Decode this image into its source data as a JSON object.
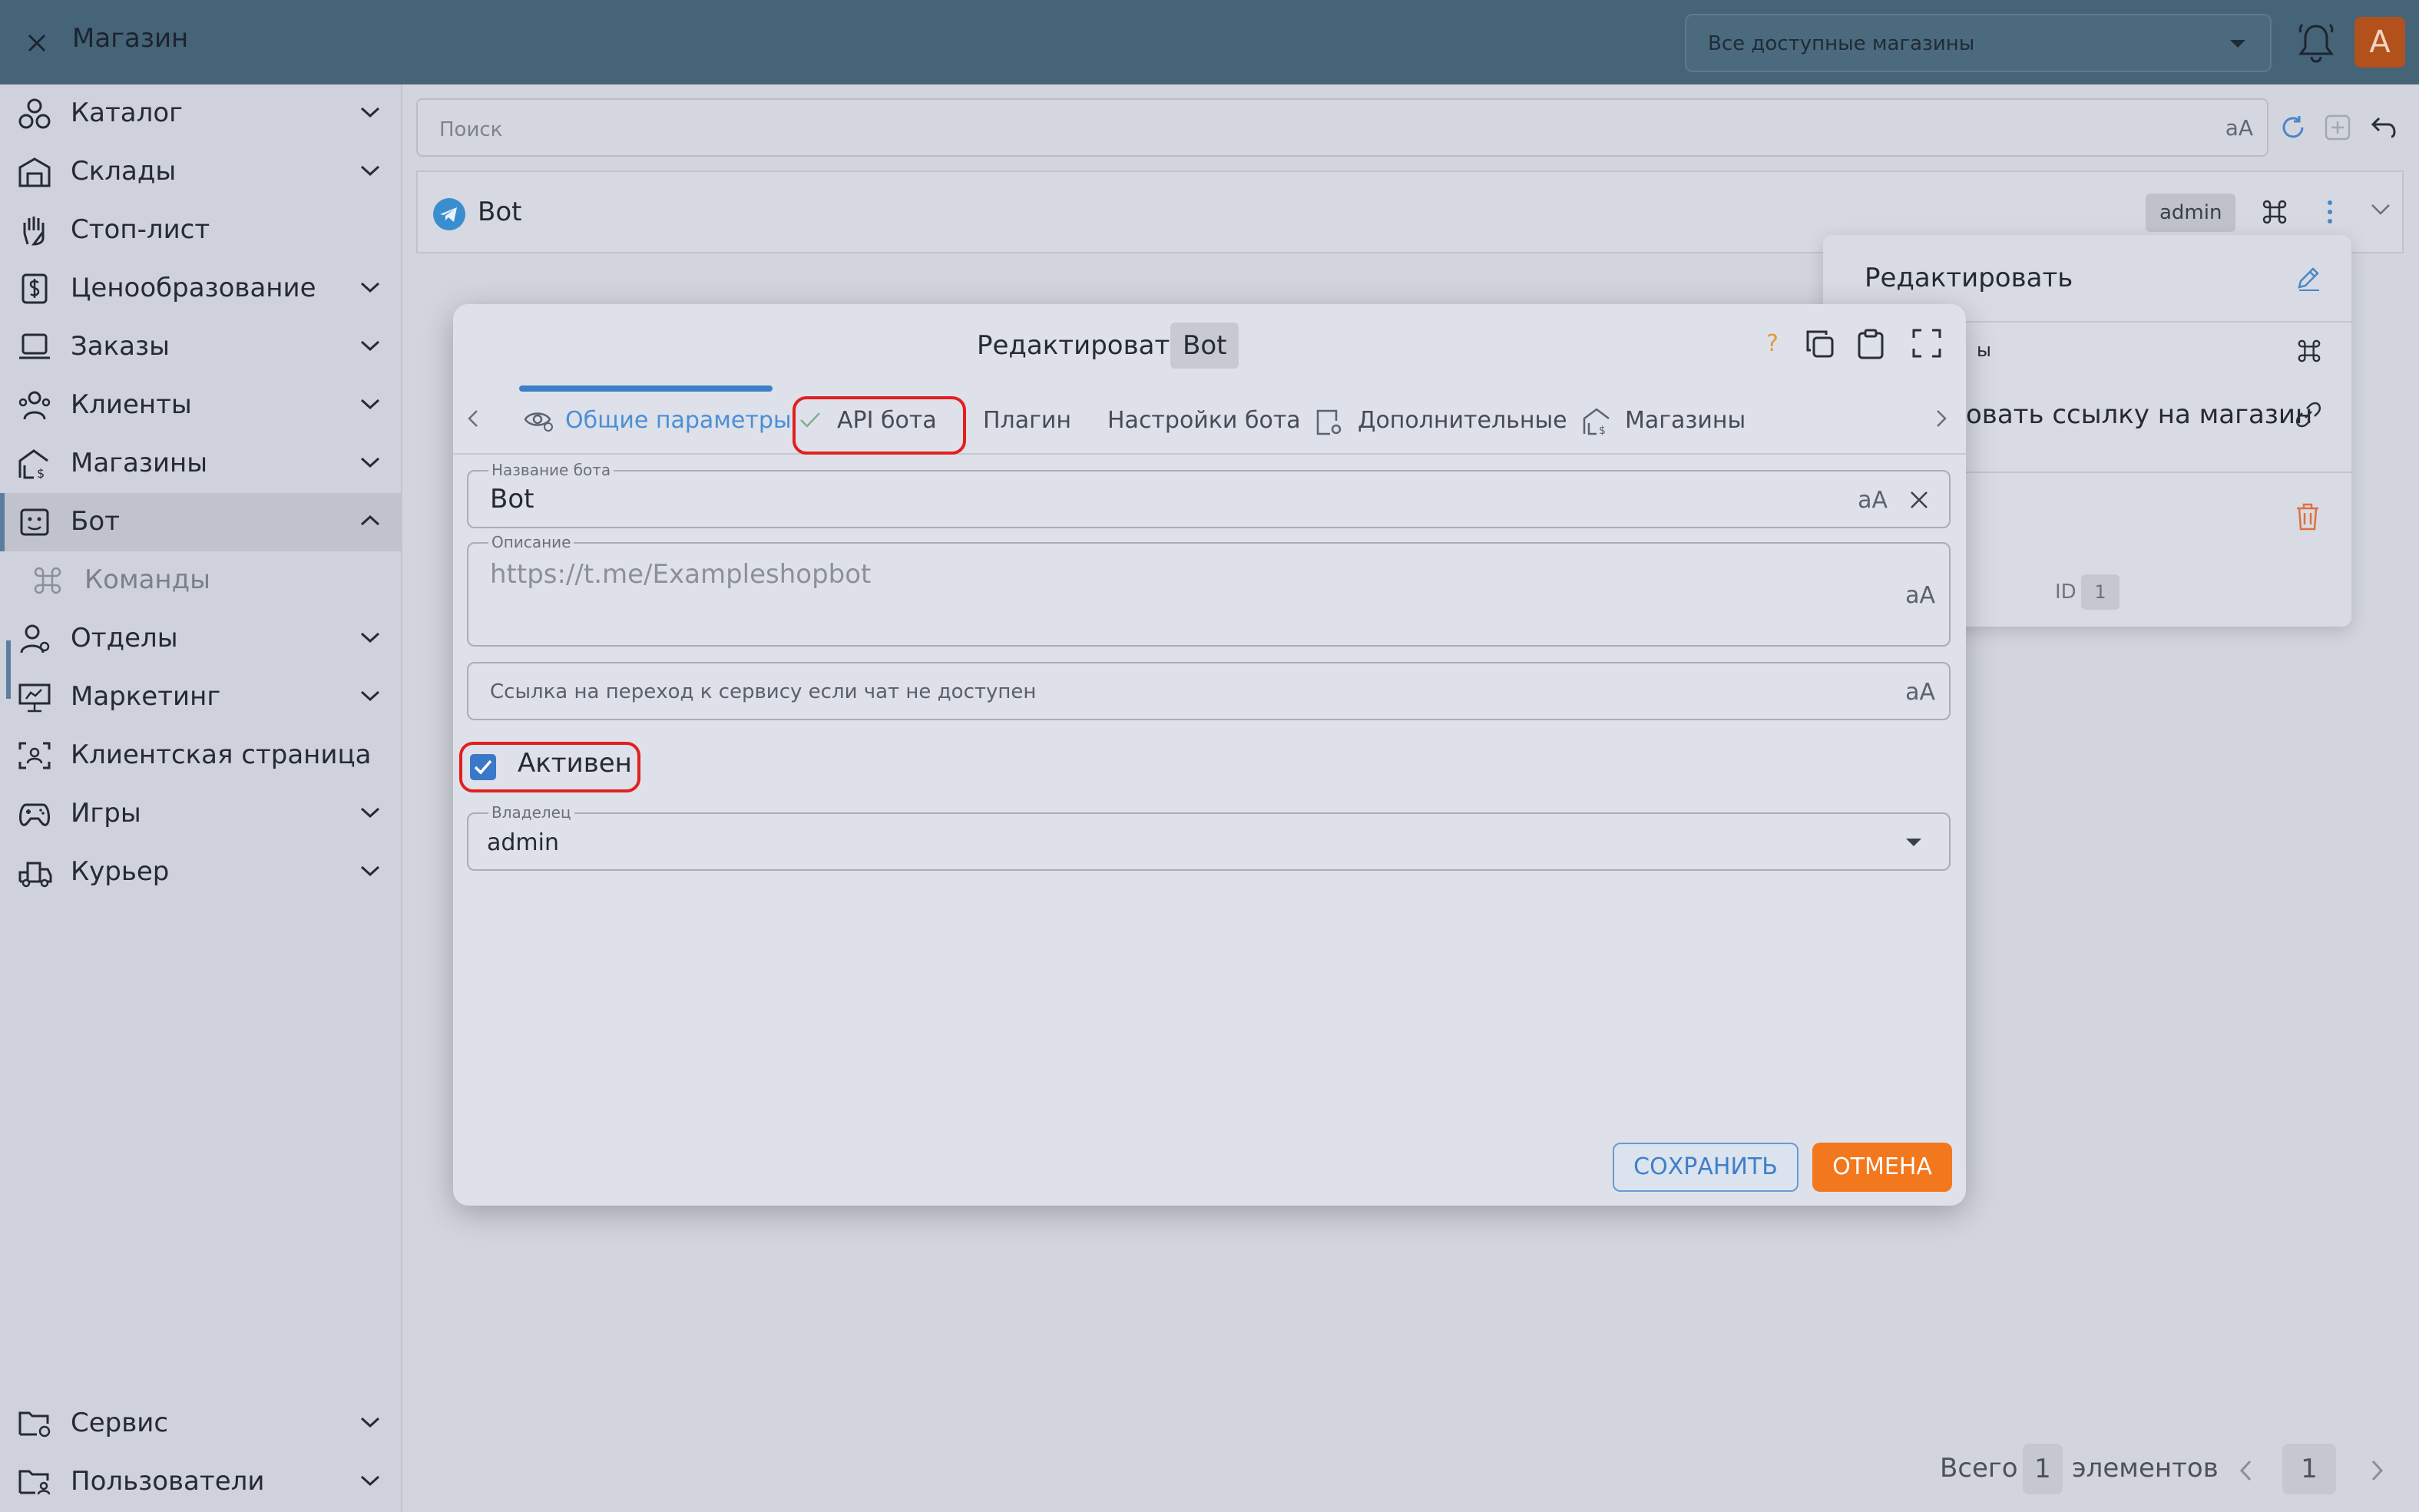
{
  "topbar": {
    "title": "Магазин",
    "shop_select": "Все доступные магазины",
    "avatar_letter": "A"
  },
  "sidebar": {
    "items": [
      {
        "label": "Каталог",
        "icon": "catalog-icon"
      },
      {
        "label": "Склады",
        "icon": "warehouse-icon"
      },
      {
        "label": "Стоп-лист",
        "icon": "hand-icon"
      },
      {
        "label": "Ценообразование",
        "icon": "pricing-icon"
      },
      {
        "label": "Заказы",
        "icon": "orders-icon"
      },
      {
        "label": "Клиенты",
        "icon": "clients-icon"
      },
      {
        "label": "Магазины",
        "icon": "shops-icon"
      },
      {
        "label": "Бот",
        "icon": "bot-icon"
      },
      {
        "label": "Команды",
        "icon": "command-icon"
      },
      {
        "label": "Отделы",
        "icon": "departments-icon"
      },
      {
        "label": "Маркетинг",
        "icon": "marketing-icon"
      },
      {
        "label": "Клиентская страница",
        "icon": "client-page-icon"
      },
      {
        "label": "Игры",
        "icon": "gamepad-icon"
      },
      {
        "label": "Курьер",
        "icon": "courier-icon"
      },
      {
        "label": "Сервис",
        "icon": "service-folder-icon"
      },
      {
        "label": "Пользователи",
        "icon": "users-folder-icon"
      }
    ]
  },
  "main": {
    "search_placeholder": "Поиск",
    "aa": "aA",
    "row_name": "Bot",
    "row_owner": "admin"
  },
  "context_menu": {
    "edit": "Редактировать",
    "commands_partial": "ы",
    "link_partial": "овать ссылку на магазин",
    "id_label": "ID",
    "id_value": "1"
  },
  "pager": {
    "total_label": "Всего",
    "total_count": "1",
    "elements_label": "элементов",
    "page": "1"
  },
  "modal": {
    "title": "Редактировать",
    "title_chip": "Bot",
    "help": "?",
    "tabs": [
      "Общие параметры",
      "API бота",
      "Плагин",
      "Настройки бота",
      "Дополнительные",
      "Магазины"
    ],
    "fields": {
      "bot_name_label": "Название бота",
      "bot_name_value": "Bot",
      "description_label": "Описание",
      "description_placeholder": "https://t.me/Exampleshopbot",
      "fallback_link_placeholder": "Ссылка на переход к сервису если чат не доступен",
      "active_label": "Активен",
      "owner_label": "Владелец",
      "owner_value": "admin"
    },
    "save": "СОХРАНИТЬ",
    "cancel": "ОТМЕНА"
  },
  "colors": {
    "topbar": "#456478",
    "accent": "#3f7fca",
    "cancel": "#f3771c",
    "highlight": "#e21f1f"
  }
}
